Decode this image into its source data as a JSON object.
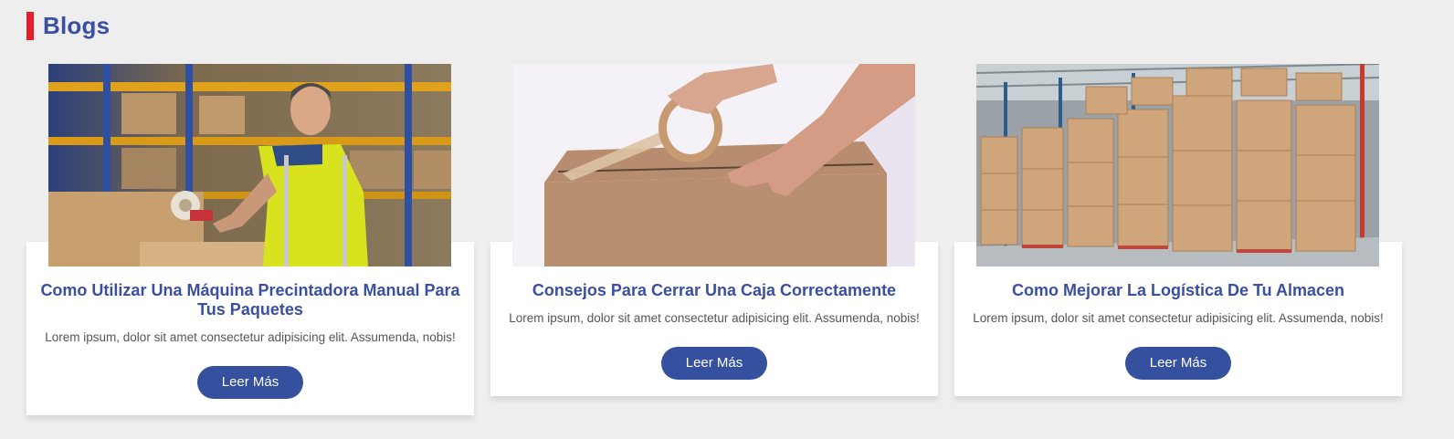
{
  "section": {
    "title": "Blogs",
    "accent_color": "#e51c2a",
    "title_color": "#3a4fa0"
  },
  "cards": [
    {
      "title": "Como Utilizar Una Máquina Precintadora Manual Para Tus Paquetes",
      "excerpt": "Lorem ipsum, dolor sit amet consectetur adipisicing elit. Assumenda, nobis!",
      "button_label": "Leer Más",
      "image": "worker-taping-box-warehouse-photo"
    },
    {
      "title": "Consejos Para Cerrar Una Caja Correctamente",
      "excerpt": "Lorem ipsum, dolor sit amet consectetur adipisicing elit. Assumenda, nobis!",
      "button_label": "Leer Más",
      "image": "hands-taping-cardboard-box-photo"
    },
    {
      "title": "Como Mejorar La Logística De Tu Almacen",
      "excerpt": "Lorem ipsum, dolor sit amet consectetur adipisicing elit. Assumenda, nobis!",
      "button_label": "Leer Más",
      "image": "warehouse-stacked-boxes-photo"
    }
  ],
  "button_color": "#34509e"
}
